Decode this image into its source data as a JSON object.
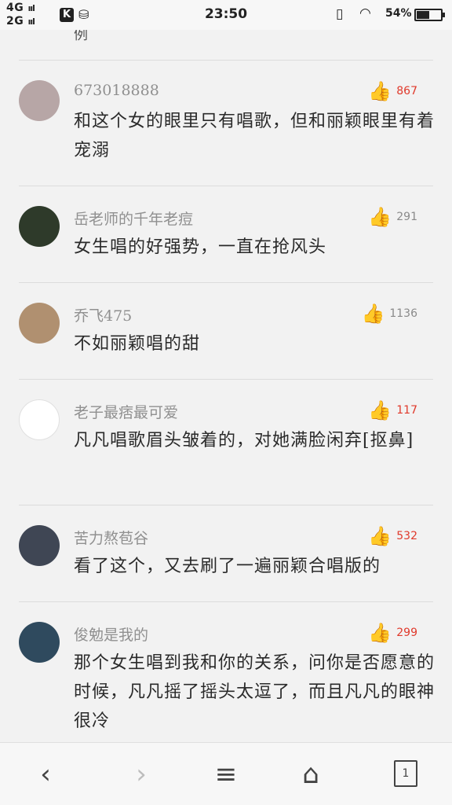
{
  "status_bar": {
    "network_top": "4G",
    "network_bottom": "2G",
    "signal_bars": "ııl",
    "app_icon": "K",
    "time": "23:50",
    "battery_percent": "54%",
    "battery_level": 0.54
  },
  "feed": {
    "top_fragment": "例",
    "comments": [
      {
        "username": "673018888",
        "text": "和这个女的眼里只有唱歌，但和丽颖眼里有着宠溺",
        "likes": "867",
        "liked": true,
        "avatar_color": "#b7a6a6"
      },
      {
        "username": "岳老师的千年老痘",
        "text": "女生唱的好强势，一直在抢风头",
        "likes": "291",
        "liked": false,
        "avatar_color": "#2e3a2a"
      },
      {
        "username": "乔飞475",
        "text": "不如丽颖唱的甜",
        "likes": "1136",
        "liked": false,
        "avatar_color": "#b09070"
      },
      {
        "username": "老子最痞最可爱",
        "text": "凡凡唱歌眉头皱着的，对她满脸闲弃[抠鼻]",
        "likes": "117",
        "liked": true,
        "avatar_color": "#ffffff"
      },
      {
        "username": "苦力熬苞谷",
        "text": "看了这个，又去刷了一遍丽颖合唱版的",
        "likes": "532",
        "liked": true,
        "avatar_color": "#3f4654"
      },
      {
        "username": "俊勉是我的",
        "text": "那个女生唱到我和你的关系，问你是否愿意的时候，凡凡摇了摇头太逗了，而且凡凡的眼神很冷",
        "likes": "299",
        "liked": true,
        "avatar_color": "#2f4a5e"
      }
    ]
  },
  "bottom_nav": {
    "back_icon": "‹",
    "forward_icon": "›",
    "menu_icon": "≡",
    "home_icon": "⌂",
    "tabs_count": "1"
  }
}
